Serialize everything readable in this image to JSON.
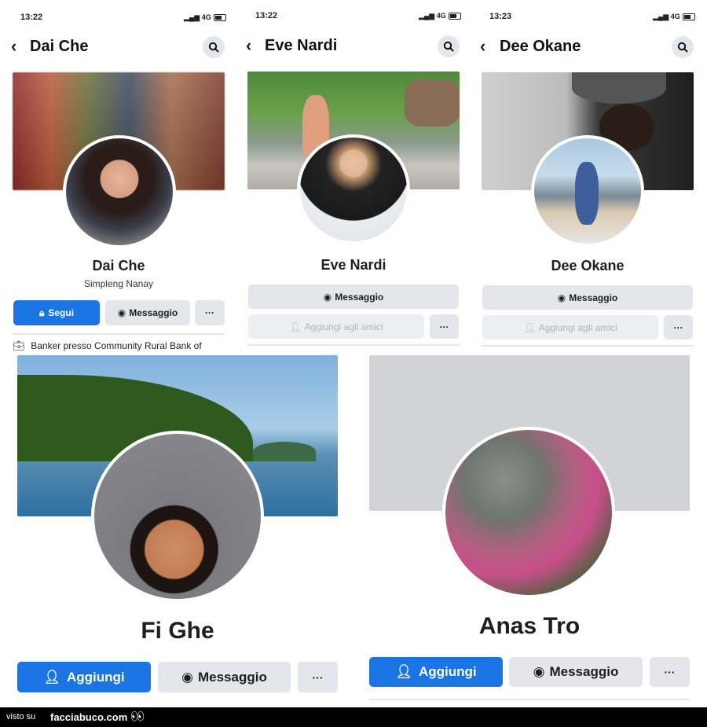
{
  "panels": [
    {
      "time": "13:22",
      "net": "4G",
      "name": "Dai Che",
      "subtitle": "Simpleng Nanay",
      "follow_label": "Segui",
      "message_label": "Messaggio",
      "more_label": "···",
      "work": "Banker presso Community Rural Bank of"
    },
    {
      "time": "13:22",
      "net": "4G",
      "name": "Eve Nardi",
      "message_label": "Messaggio",
      "add_label": "Aggiungi agli amici",
      "more_label": "···"
    },
    {
      "time": "13:23",
      "net": "4G",
      "name": "Dee Okane",
      "message_label": "Messaggio",
      "add_label": "Aggiungi agli amici",
      "more_label": "···"
    },
    {
      "name": "Fi Ghe",
      "add_label": "Aggiungi",
      "message_label": "Messaggio",
      "more_label": "···"
    },
    {
      "name": "Anas Tro",
      "add_label": "Aggiungi",
      "message_label": "Messaggio",
      "more_label": "···"
    }
  ],
  "footer": {
    "prefix": "visto su",
    "site": "facciabuco.com"
  },
  "colors": {
    "primary": "#1b74e4",
    "button_gray": "#e4e6eb",
    "footer_bg": "#000000"
  }
}
